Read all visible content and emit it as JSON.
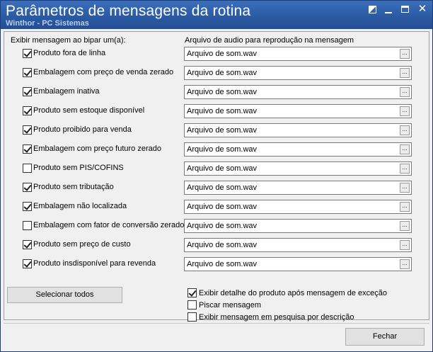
{
  "window": {
    "title": "Parâmetros de mensagens da rotina",
    "subtitle": "Winthor - PC Sistemas"
  },
  "main": {
    "left_header": "Exibir mensagem ao bipar um(a):",
    "right_header": "Arquivo de audio para reprodução na mensagem",
    "browse_label": "...",
    "items": [
      {
        "label": "Produto fora de linha",
        "checked": true,
        "file": "Arquivo de som.wav"
      },
      {
        "label": "Embalagem com preço de venda zerado",
        "checked": true,
        "file": "Arquivo de som.wav"
      },
      {
        "label": "Embalagem inativa",
        "checked": true,
        "file": "Arquivo de som.wav"
      },
      {
        "label": "Produto sem estoque disponível",
        "checked": true,
        "file": "Arquivo de som.wav"
      },
      {
        "label": "Produto proibido para venda",
        "checked": true,
        "file": "Arquivo de som.wav"
      },
      {
        "label": "Embalagem com preço futuro zerado",
        "checked": true,
        "file": "Arquivo de som.wav"
      },
      {
        "label": "Produto sem PIS/COFINS",
        "checked": false,
        "file": "Arquivo de som.wav"
      },
      {
        "label": "Produto sem tributação",
        "checked": true,
        "file": "Arquivo de som.wav"
      },
      {
        "label": "Embalagem não localizada",
        "checked": true,
        "file": "Arquivo de som.wav"
      },
      {
        "label": "Embalagem com fator de conversão zerado",
        "checked": false,
        "file": "Arquivo de som.wav"
      },
      {
        "label": "Produto sem preço de custo",
        "checked": true,
        "file": "Arquivo de som.wav"
      },
      {
        "label": "Produto insdisponível para revenda",
        "checked": true,
        "file": "Arquivo de som.wav"
      }
    ],
    "select_all_label": "Selecionar todos",
    "options": [
      {
        "label": "Exibir detalhe do produto após mensagem de exceção",
        "checked": true
      },
      {
        "label": "Piscar mensagem",
        "checked": false
      },
      {
        "label": "Exibir mensagem em pesquisa por descrição",
        "checked": false
      }
    ]
  },
  "footer": {
    "close_label": "Fechar"
  }
}
